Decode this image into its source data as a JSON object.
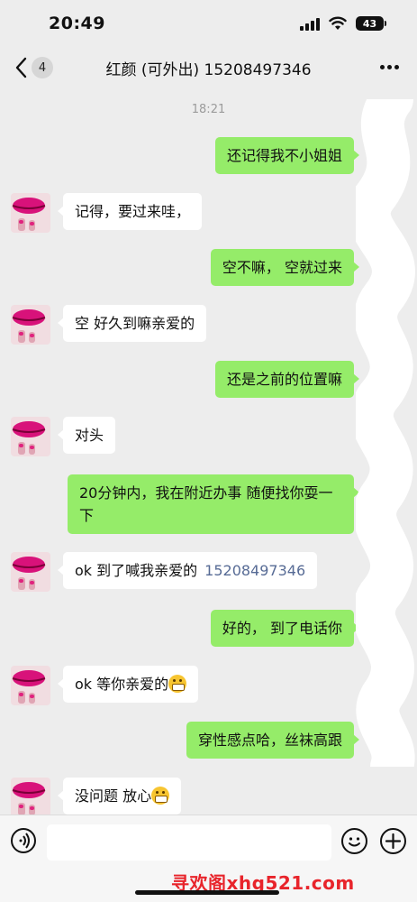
{
  "status_bar": {
    "time": "20:49",
    "battery": "43"
  },
  "nav": {
    "badge": "4",
    "title": "红颜 (可外出) 15208497346"
  },
  "chat": {
    "timestamp": "18:21",
    "messages": [
      {
        "from": "me",
        "text": "还记得我不小姐姐"
      },
      {
        "from": "them",
        "text": "记得，要过来哇，"
      },
      {
        "from": "me",
        "text": "空不嘛， 空就过来"
      },
      {
        "from": "them",
        "text": "空 好久到嘛亲爱的"
      },
      {
        "from": "me",
        "text": "还是之前的位置嘛"
      },
      {
        "from": "them",
        "text": "对头"
      },
      {
        "from": "me",
        "text": "20分钟内，我在附近办事 随便找你耍一下"
      },
      {
        "from": "them",
        "text": "ok 到了喊我亲爱的",
        "link": "15208497346"
      },
      {
        "from": "me",
        "text": "好的， 到了电话你"
      },
      {
        "from": "them",
        "text": "ok 等你亲爱的"
      },
      {
        "from": "me",
        "text": "穿性感点哈，丝袜高跟"
      },
      {
        "from": "them",
        "text": "没问题 放心"
      }
    ]
  },
  "input_bar": {
    "placeholder": ""
  },
  "watermark": "寻欢阁xhg521.com",
  "colors": {
    "me_bubble": "#95ec69",
    "them_bubble": "#ffffff",
    "background": "#ededed",
    "link": "#576b95",
    "watermark": "#e8242b"
  },
  "icons": [
    "back-chevron-icon",
    "more-icon",
    "voice-icon",
    "emoji-icon",
    "plus-icon",
    "grin-emoji-icon"
  ]
}
